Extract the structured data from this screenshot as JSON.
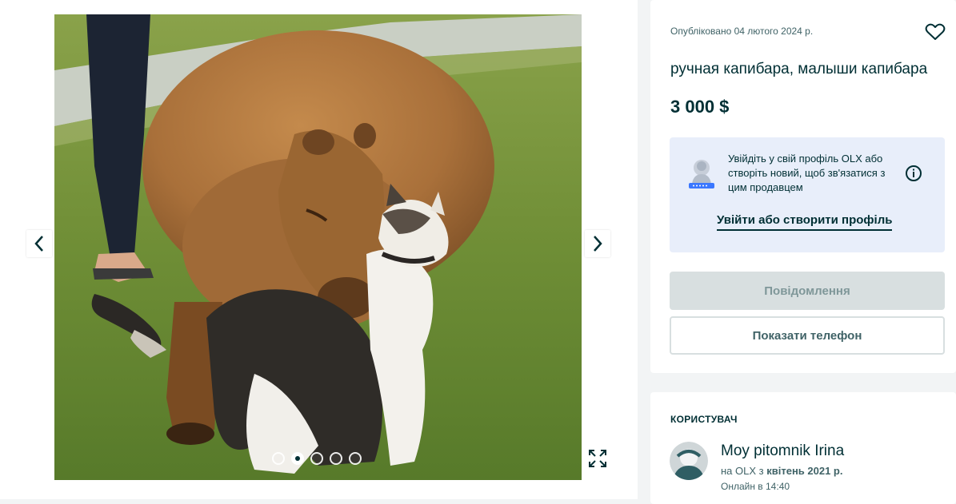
{
  "gallery": {
    "photo_alt": "",
    "image_count": 5,
    "active_index": 1
  },
  "listing": {
    "posted": "Опубліковано 04 лютого 2024 р.",
    "title": "ручная капибара, малыши капибара",
    "price": "3 000 $"
  },
  "login": {
    "text": "Увійдіть у свій профіль OLX або створіть новий, щоб зв'язатися з цим продавцем",
    "link_label": "Увійти або створити профіль"
  },
  "actions": {
    "message_label": "Повідомлення",
    "phone_label": "Показати телефон"
  },
  "user": {
    "heading": "КОРИСТУВАЧ",
    "name": "Moy pitomnik Irina",
    "since_prefix": "на OLX з",
    "since_date": "квітень 2021 р.",
    "online": "Онлайн в 14:40"
  },
  "colors": {
    "brand_dark": "#002f34",
    "login_bg": "#e8eefa",
    "disabled_button": "#d8dfe0"
  },
  "icons": [
    "chevron-left-icon",
    "chevron-right-icon",
    "fullscreen-icon",
    "heart-icon",
    "info-icon",
    "profile-illustration-icon"
  ]
}
